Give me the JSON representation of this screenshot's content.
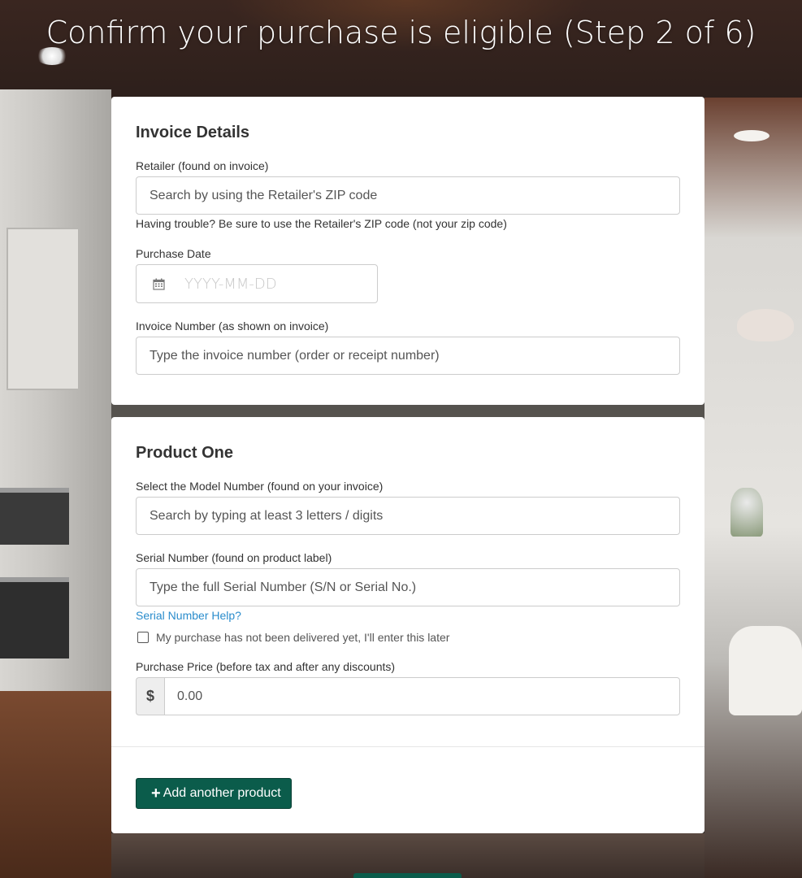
{
  "header": {
    "title": "Confirm your purchase is eligible (Step 2 of 6)"
  },
  "invoice": {
    "section_title": "Invoice Details",
    "retailer": {
      "label": "Retailer (found on invoice)",
      "placeholder": "Search by using the Retailer's ZIP code",
      "help": "Having trouble? Be sure to use the Retailer's ZIP code (not your zip code)"
    },
    "purchase_date": {
      "label": "Purchase Date",
      "placeholder": "YYYY-MM-DD",
      "icon": "calendar-icon"
    },
    "invoice_number": {
      "label": "Invoice Number (as shown on invoice)",
      "placeholder": "Type the invoice number (order or receipt number)"
    }
  },
  "product": {
    "section_title": "Product One",
    "model_number": {
      "label": "Select the Model Number (found on your invoice)",
      "placeholder": "Search by typing at least 3 letters / digits"
    },
    "serial_number": {
      "label": "Serial Number (found on product label)",
      "placeholder": "Type the full Serial Number (S/N or Serial No.)",
      "help_link": "Serial Number Help?"
    },
    "not_delivered": {
      "label": "My purchase has not been delivered yet, I'll enter this later",
      "checked": false
    },
    "purchase_price": {
      "label": "Purchase Price (before tax and after any discounts)",
      "currency_symbol": "$",
      "placeholder": "0.00"
    },
    "add_button": {
      "label": "Add another product",
      "icon": "plus-icon"
    }
  },
  "colors": {
    "primary_button": "#0b5c4b",
    "link": "#2a8ccc",
    "card_bg": "#ffffff"
  }
}
